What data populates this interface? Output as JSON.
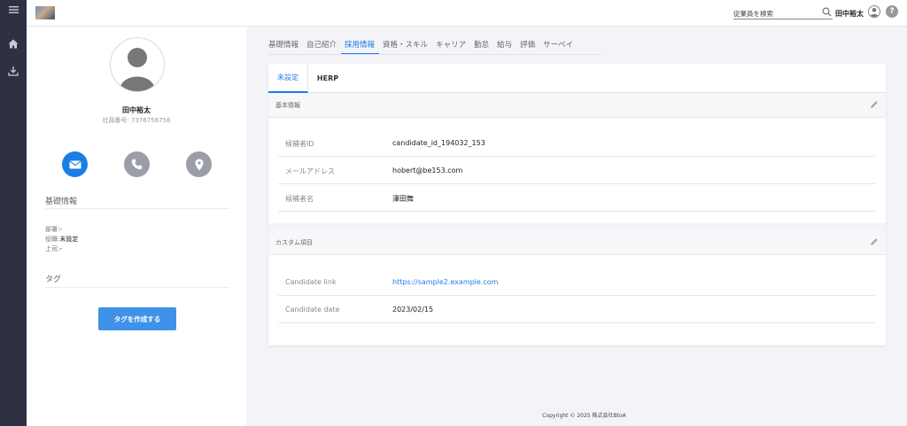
{
  "header": {
    "search_placeholder": "従業員を検索",
    "user_name": "田中裕太"
  },
  "profile": {
    "name": "田中裕太",
    "employee_no": "社員番号: 7376756756",
    "basic_title": "基礎情報",
    "fields": [
      {
        "label": "部署:",
        "value": "-"
      },
      {
        "label": "役職:",
        "value": "未設定"
      },
      {
        "label": "上司:",
        "value": "-"
      }
    ],
    "tag_title": "タグ",
    "create_tag_button": "タグを作成する"
  },
  "nav": {
    "tabs": [
      "基礎情報",
      "自己紹介",
      "採用情報",
      "資格・スキル",
      "キャリア",
      "勤怠",
      "給与",
      "評価",
      "サーベイ"
    ],
    "active_index": 2
  },
  "recruit": {
    "subtabs": [
      "未設定",
      "HERP"
    ],
    "basic_section_title": "基本情報",
    "basic_rows": [
      {
        "label": "候補者ID",
        "value": "candidate_id_194032_153"
      },
      {
        "label": "メールアドレス",
        "value": "hobert@be153.com"
      },
      {
        "label": "候補者名",
        "value": "澤田舞"
      }
    ],
    "custom_section_title": "カスタム項目",
    "custom_rows": [
      {
        "label": "Candidate link",
        "value": "https://sample2.example.com"
      },
      {
        "label": "Candidate date",
        "value": "2023/02/15"
      }
    ]
  },
  "footer": {
    "copyright": "Copyright © 2025 株式会社BtoA"
  },
  "colors": {
    "accent": "#1a7ee6",
    "rail": "#2d3142",
    "button_blue": "#3f92e8"
  }
}
